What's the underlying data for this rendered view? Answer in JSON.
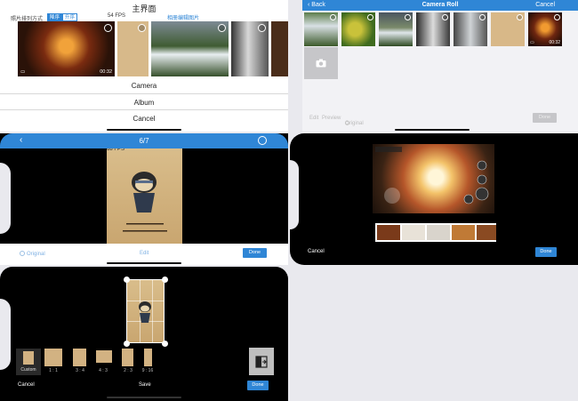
{
  "main_screen": {
    "title": "主界面",
    "sort_label": "照片排列方式",
    "sort_options": [
      "降序",
      "升序"
    ],
    "fps": "54 FPS",
    "select_album_link": "相册编辑图片",
    "thumb_duration": "00:32",
    "sheet": {
      "camera": "Camera",
      "album": "Album",
      "cancel": "Cancel"
    }
  },
  "camera_roll": {
    "back": "Back",
    "title": "Camera Roll",
    "cancel": "Cancel",
    "duration": "00:32",
    "toolbar": {
      "edit": "Edit",
      "preview": "Preview",
      "original": "Original",
      "done": "Done"
    }
  },
  "preview": {
    "counter": "6/7",
    "fps": "68 FPS",
    "original": "Original",
    "edit": "Edit",
    "done": "Done"
  },
  "video_edit": {
    "cancel": "Cancel",
    "done": "Done"
  },
  "crop": {
    "ratios": [
      "Custom",
      "1 : 1",
      "3 : 4",
      "4 : 3",
      "2 : 3",
      "9 : 16"
    ],
    "cancel": "Cancel",
    "save": "Save",
    "done": "Done"
  },
  "icons": {
    "back": "chevron-left-icon",
    "camera": "camera-icon",
    "check": "check-circle-icon",
    "rotate": "rotate-flip-icon"
  },
  "colors": {
    "accent": "#2f86d6",
    "disabled": "#c6c6c9"
  }
}
